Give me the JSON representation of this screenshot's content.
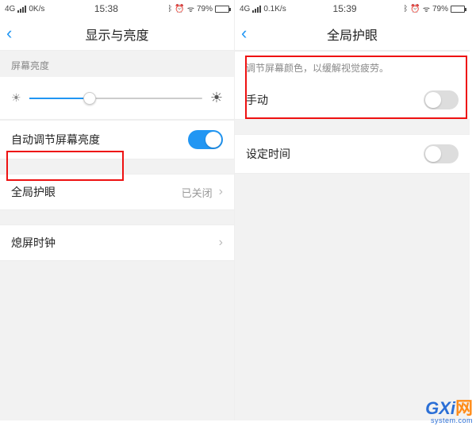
{
  "left": {
    "status": {
      "net": "4G",
      "speed": "0K/s",
      "time": "15:38",
      "battery_pct": "79%"
    },
    "nav_title": "显示与亮度",
    "brightness_label": "屏幕亮度",
    "auto_brightness_label": "自动调节屏幕亮度",
    "auto_brightness_on": true,
    "eye_row_label": "全局护眼",
    "eye_status": "已关闭",
    "clock_row_label": "熄屏时钟"
  },
  "right": {
    "status": {
      "net": "4G",
      "speed": "0.1K/s",
      "time": "15:39",
      "battery_pct": "79%"
    },
    "nav_title": "全局护眼",
    "hint": "调节屏幕颜色，以缓解视觉疲劳。",
    "manual_label": "手动",
    "manual_on": false,
    "schedule_label": "设定时间",
    "schedule_on": false
  },
  "watermark": {
    "brand": "GXi",
    "brand_suffix": "网",
    "sub": "system.com"
  }
}
